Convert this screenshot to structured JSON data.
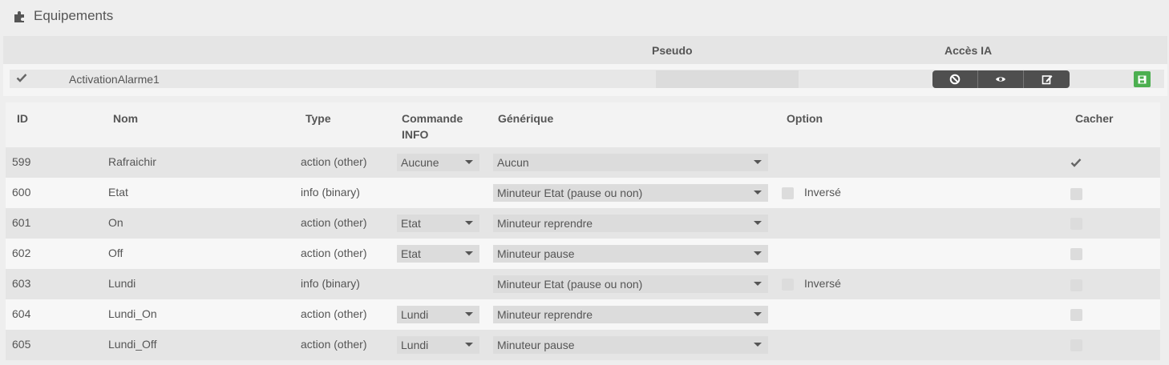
{
  "page": {
    "title": "Equipements",
    "title_icon": "puzzle-icon"
  },
  "equipment_header": {
    "pseudo": "Pseudo",
    "acces_ia": "Accès IA"
  },
  "equipment": {
    "name": "ActivationAlarme1",
    "pseudo_value": "",
    "checked": true,
    "buttons": [
      "ban-icon",
      "eye-icon",
      "edit-icon"
    ],
    "save_icon": "save-icon"
  },
  "commands_header": {
    "id": "ID",
    "nom": "Nom",
    "type": "Type",
    "commande_info_1": "Commande",
    "commande_info_2": "INFO",
    "generique": "Générique",
    "option": "Option",
    "cacher": "Cacher"
  },
  "commands": [
    {
      "id": "599",
      "nom": "Rafraichir",
      "type": "action (other)",
      "info": "Aucune",
      "generique": "Aucun",
      "option": "",
      "cacher": true
    },
    {
      "id": "600",
      "nom": "Etat",
      "type": "info (binary)",
      "info": "",
      "generique": "Minuteur Etat (pause ou non)",
      "option": "Inversé",
      "cacher": false
    },
    {
      "id": "601",
      "nom": "On",
      "type": "action (other)",
      "info": "Etat",
      "generique": "Minuteur reprendre",
      "option": "",
      "cacher": false
    },
    {
      "id": "602",
      "nom": "Off",
      "type": "action (other)",
      "info": "Etat",
      "generique": "Minuteur pause",
      "option": "",
      "cacher": false
    },
    {
      "id": "603",
      "nom": "Lundi",
      "type": "info (binary)",
      "info": "",
      "generique": "Minuteur Etat (pause ou non)",
      "option": "Inversé",
      "cacher": false
    },
    {
      "id": "604",
      "nom": "Lundi_On",
      "type": "action (other)",
      "info": "Lundi",
      "generique": "Minuteur reprendre",
      "option": "",
      "cacher": false
    },
    {
      "id": "605",
      "nom": "Lundi_Off",
      "type": "action (other)",
      "info": "Lundi",
      "generique": "Minuteur pause",
      "option": "",
      "cacher": false
    }
  ],
  "colors": {
    "save_button": "#4caf50",
    "button_group": "#4f4f4f"
  }
}
